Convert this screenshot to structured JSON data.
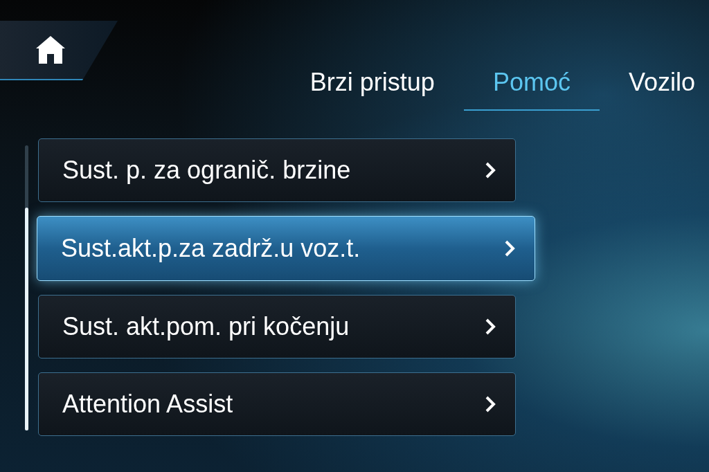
{
  "home_button": {
    "selected": false
  },
  "tabs": [
    {
      "label": "Brzi pristup",
      "selected": false
    },
    {
      "label": "Pomoć",
      "selected": true
    },
    {
      "label": "Vozilo",
      "selected": false
    }
  ],
  "menu": [
    {
      "label": "Sust. p. za ogranič. brzine",
      "selected": false
    },
    {
      "label": "Sust.akt.p.za zadrž.u voz.t.",
      "selected": true
    },
    {
      "label": "Sust. akt.pom. pri kočenju",
      "selected": false
    },
    {
      "label": "Attention Assist",
      "selected": false
    }
  ]
}
